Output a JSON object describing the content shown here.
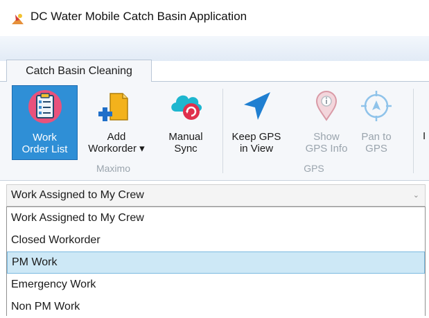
{
  "window": {
    "title": "DC Water Mobile Catch Basin Application"
  },
  "ribbon": {
    "active_tab": "Catch Basin Cleaning",
    "groups": [
      {
        "label": "Maximo"
      },
      {
        "label": "GPS"
      }
    ],
    "buttons": [
      {
        "line1": "Work",
        "line2": "Order List",
        "selected": true
      },
      {
        "line1": "Add",
        "line2": "Workorder ▾"
      },
      {
        "line1": "Manual",
        "line2": "Sync"
      },
      {
        "line1": "Keep GPS",
        "line2": "in View"
      },
      {
        "line1": "Show",
        "line2": "GPS Info",
        "disabled": true
      },
      {
        "line1": "Pan to",
        "line2": "GPS",
        "disabled": true
      }
    ],
    "overflow_glyph": "I"
  },
  "filter": {
    "selected": "Work Assigned to My Crew",
    "options": [
      "Work Assigned to My Crew",
      "Closed Workorder",
      "PM Work",
      "Emergency Work",
      "Non PM Work"
    ],
    "highlighted_index": 2
  },
  "colors": {
    "selection_blue": "#2f8fd6",
    "list_highlight": "#cde8f6",
    "arrow_blue": "#1f7fd1",
    "cloud_teal": "#1eb6cf",
    "sync_red": "#e0304d"
  }
}
